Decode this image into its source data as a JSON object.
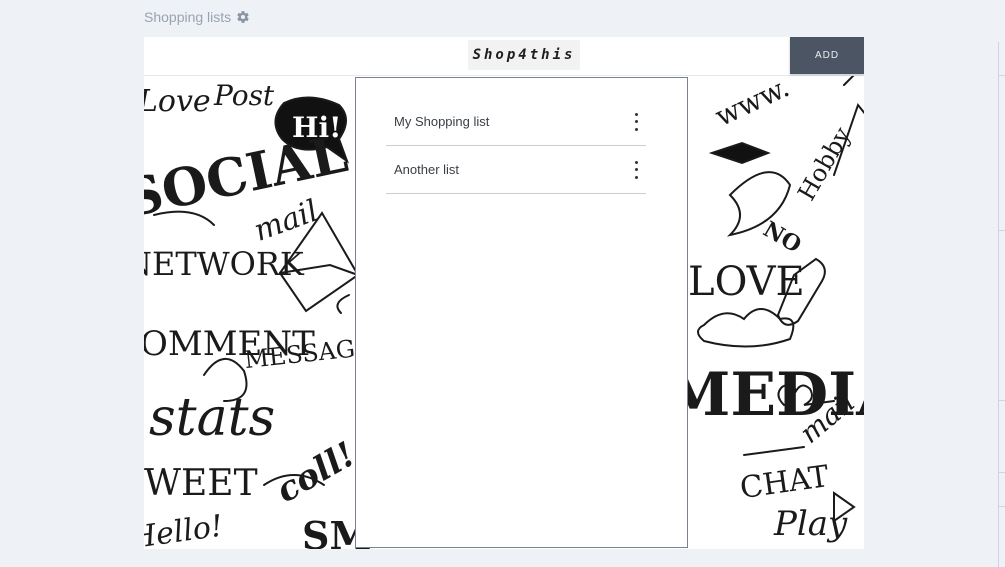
{
  "header": {
    "title": "Shopping lists",
    "settings_icon": "gear-icon"
  },
  "toolbar": {
    "logo_text": "Shop4this",
    "add_label": "ADD"
  },
  "lists": [
    {
      "name": "My Shopping list",
      "menu_icon": "more-vert-icon"
    },
    {
      "name": "Another  list",
      "menu_icon": "more-vert-icon"
    }
  ],
  "background": {
    "doodle_words": [
      "Love",
      "Post",
      "SOCIAL",
      "Hi!",
      "mail",
      "NETWORK",
      "COMMENT",
      "MESSAGE",
      "stats",
      "coll!",
      "TWEET",
      "Hello!",
      "www.",
      "Hobby",
      "NO",
      "LOVE",
      "MEDIA",
      "mail",
      "CHAT",
      "Play",
      "SM"
    ]
  },
  "colors": {
    "page_bg": "#eef1f6",
    "muted_text": "#9aa3b0",
    "button_bg": "#4b5563",
    "panel_border": "#7a828f"
  }
}
